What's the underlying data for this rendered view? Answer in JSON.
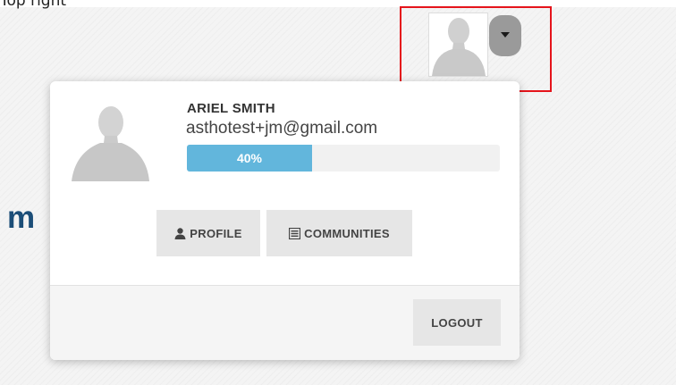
{
  "page": {
    "top_caption": "Top right",
    "brand_fragment": "m"
  },
  "header": {
    "avatar_icon": "avatar-icon",
    "menu_caret_icon": "caret-down-icon"
  },
  "dropdown": {
    "user_name": "ARIEL SMITH",
    "email": "asthotest+jm@gmail.com",
    "profile_progress": {
      "label": "40%",
      "value": 0.4
    },
    "buttons": {
      "profile_label": "PROFILE",
      "profile_icon": "user-icon",
      "communities_label": "COMMUNITIES",
      "communities_icon": "list-icon",
      "logout_label": "LOGOUT"
    }
  },
  "colors": {
    "progress_fill": "#62b6dc",
    "highlight_border": "#e5141b",
    "brand": "#1c4e78"
  }
}
